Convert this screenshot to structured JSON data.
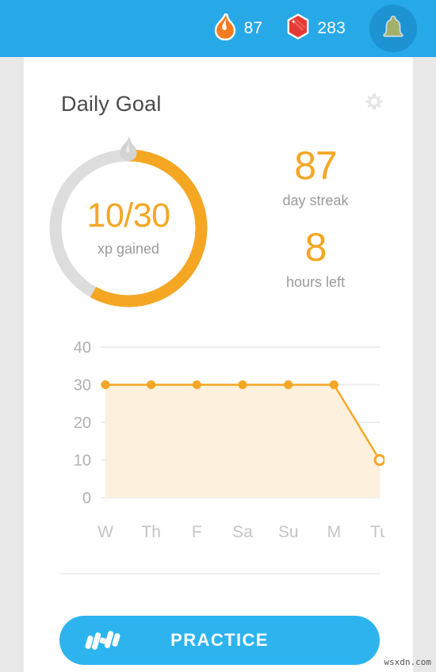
{
  "header": {
    "streak": {
      "icon": "flame-icon",
      "value": "87",
      "color": "#f47c20"
    },
    "gems": {
      "icon": "gem-icon",
      "value": "283",
      "color": "#e53935"
    },
    "notifications": {
      "icon": "bell-icon",
      "color": "#a3b06a"
    },
    "bar_color": "#27a8e7"
  },
  "card": {
    "title": "Daily Goal",
    "settings_icon": "gear-icon",
    "goal": {
      "xp_text": "10/30",
      "xp_label": "xp gained",
      "xp_current": 10,
      "xp_target": 30,
      "progress_percent": 58,
      "ring_marker_icon": "flame-icon",
      "accent_color": "#f5a623",
      "track_color": "#dddddd"
    },
    "stats": [
      {
        "value": "87",
        "label": "day streak"
      },
      {
        "value": "8",
        "label": "hours left"
      }
    ],
    "practice_button": {
      "label": "PRACTICE",
      "icon": "dumbbell-icon",
      "color": "#2db4ef"
    }
  },
  "chart_data": {
    "type": "line",
    "title": "",
    "xlabel": "",
    "ylabel": "",
    "categories": [
      "W",
      "Th",
      "F",
      "Sa",
      "Su",
      "M",
      "Tu"
    ],
    "values": [
      30,
      30,
      30,
      30,
      30,
      30,
      10
    ],
    "ylim": [
      0,
      40
    ],
    "yticks": [
      0,
      10,
      20,
      30,
      40
    ],
    "ytick_labels": [
      "0",
      "10",
      "20",
      "30",
      "40"
    ],
    "grid": true,
    "legend": "none",
    "line_color": "#f5a623",
    "fill_color": "#fdf0dc",
    "point_style": [
      "filled",
      "filled",
      "filled",
      "filled",
      "filled",
      "filled",
      "hollow"
    ]
  },
  "watermark": "wsxdn.com"
}
